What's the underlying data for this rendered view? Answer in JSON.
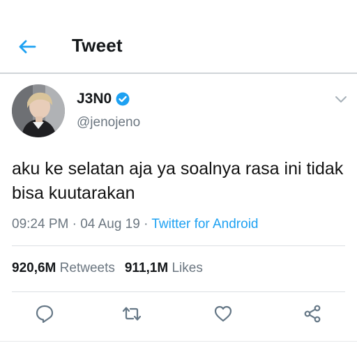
{
  "header": {
    "title": "Tweet",
    "back_icon": "arrow-left-icon"
  },
  "tweet": {
    "display_name": "J3N0",
    "verified_icon": "verified-badge-icon",
    "handle": "@jenojeno",
    "text": "aku ke selatan aja ya soalnya rasa ini tidak bisa kuutarakan",
    "time": "09:24 PM",
    "separator": "·",
    "date": "04 Aug 19",
    "source": "Twitter for Android",
    "retweets_count": "920,6M",
    "retweets_label": "Retweets",
    "likes_count": "911,1M",
    "likes_label": "Likes"
  },
  "actions": [
    "reply-icon",
    "retweet-icon",
    "like-icon",
    "share-icon"
  ],
  "colors": {
    "accent": "#1da1f2",
    "secondary_text": "#6b7680",
    "icon_gray": "#657786"
  }
}
